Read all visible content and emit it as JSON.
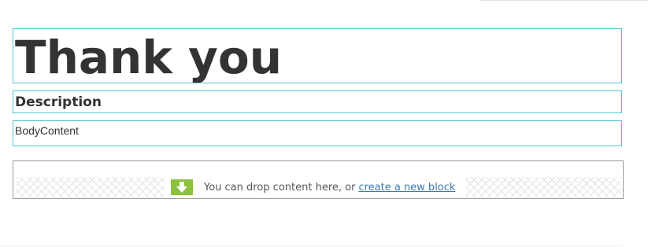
{
  "title": {
    "text": "Thank you"
  },
  "description": {
    "text": "Description"
  },
  "body_content": {
    "text": "BodyContent"
  },
  "drop_zone": {
    "message": "You can drop content here, or",
    "link_label": "create a new block",
    "icon": "arrow-down-icon",
    "icon_color": "#8dc03d"
  },
  "colors": {
    "block_border": "#4fc3d0",
    "link": "#3b78b4",
    "text": "#333333"
  }
}
